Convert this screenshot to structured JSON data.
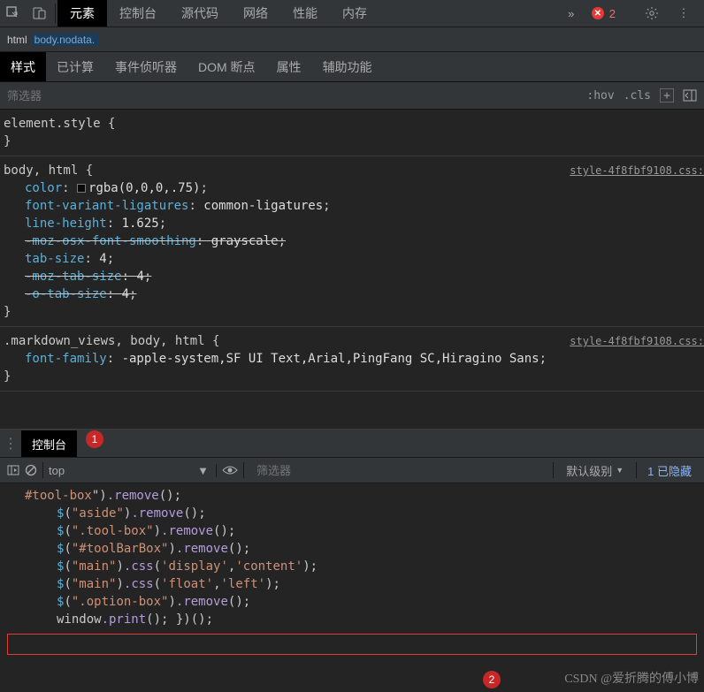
{
  "topbar": {
    "tabs": [
      "元素",
      "控制台",
      "源代码",
      "网络",
      "性能",
      "内存"
    ],
    "active_index": 0,
    "more_label": "»",
    "error_count": "2"
  },
  "breadcrumb": {
    "root": "html",
    "current": "body.nodata."
  },
  "styles_tabs": {
    "items": [
      "样式",
      "已计算",
      "事件侦听器",
      "DOM 断点",
      "属性",
      "辅助功能"
    ],
    "active_index": 0
  },
  "filter": {
    "placeholder": "筛选器",
    "hov": ":hov",
    "cls": ".cls",
    "plus": "+"
  },
  "css_rules": [
    {
      "selector": "element.style",
      "source": "",
      "decls": []
    },
    {
      "selector": "body, html",
      "source": "style-4f8fbf9108.css:",
      "decls": [
        {
          "prop": "color",
          "val": "rgba(0,0,0,.75)",
          "swatch": true,
          "strike": false
        },
        {
          "prop": "font-variant-ligatures",
          "val": "common-ligatures",
          "strike": false
        },
        {
          "prop": "line-height",
          "val": "1.625",
          "strike": false
        },
        {
          "prop": "-moz-osx-font-smoothing",
          "val": "grayscale",
          "strike": true
        },
        {
          "prop": "tab-size",
          "val": "4",
          "strike": false
        },
        {
          "prop": "-moz-tab-size",
          "val": "4",
          "strike": true
        },
        {
          "prop": "-o-tab-size",
          "val": "4",
          "strike": true
        }
      ]
    },
    {
      "selector": ".markdown_views, body, html",
      "source": "style-4f8fbf9108.css:",
      "decls": [
        {
          "prop": "font-family",
          "val": "-apple-system,SF UI Text,Arial,PingFang SC,Hiragino Sans",
          "strike": false
        }
      ]
    }
  ],
  "drawer": {
    "tab_label": "控制台",
    "annotation1": "1"
  },
  "console": {
    "context": "top",
    "filter_placeholder": "筛选器",
    "level": "默认级别",
    "hidden": "1 已隐藏",
    "lines": [
      [
        {
          "t": "#tool-box",
          "c": "js-s"
        },
        {
          "t": "\")",
          "c": "js-p"
        },
        {
          "t": ".remove",
          "c": "js-m"
        },
        {
          "t": "();",
          "c": "js-p"
        }
      ],
      [
        {
          "t": "$",
          "c": "js-fn"
        },
        {
          "t": "(",
          "c": "js-p"
        },
        {
          "t": "\"aside\"",
          "c": "js-s"
        },
        {
          "t": ")",
          "c": "js-p"
        },
        {
          "t": ".remove",
          "c": "js-m"
        },
        {
          "t": "();",
          "c": "js-p"
        }
      ],
      [
        {
          "t": "$",
          "c": "js-fn"
        },
        {
          "t": "(",
          "c": "js-p"
        },
        {
          "t": "\".tool-box\"",
          "c": "js-s"
        },
        {
          "t": ")",
          "c": "js-p"
        },
        {
          "t": ".remove",
          "c": "js-m"
        },
        {
          "t": "();",
          "c": "js-p"
        }
      ],
      [
        {
          "t": "$",
          "c": "js-fn"
        },
        {
          "t": "(",
          "c": "js-p"
        },
        {
          "t": "\"#toolBarBox\"",
          "c": "js-s"
        },
        {
          "t": ")",
          "c": "js-p"
        },
        {
          "t": ".remove",
          "c": "js-m"
        },
        {
          "t": "();",
          "c": "js-p"
        }
      ],
      [
        {
          "t": "$",
          "c": "js-fn"
        },
        {
          "t": "(",
          "c": "js-p"
        },
        {
          "t": "\"main\"",
          "c": "js-s"
        },
        {
          "t": ")",
          "c": "js-p"
        },
        {
          "t": ".css",
          "c": "js-m"
        },
        {
          "t": "(",
          "c": "js-p"
        },
        {
          "t": "'display'",
          "c": "js-s"
        },
        {
          "t": ",",
          "c": "js-p"
        },
        {
          "t": "'content'",
          "c": "js-s"
        },
        {
          "t": ");",
          "c": "js-p"
        }
      ],
      [
        {
          "t": "$",
          "c": "js-fn"
        },
        {
          "t": "(",
          "c": "js-p"
        },
        {
          "t": "\"main\"",
          "c": "js-s"
        },
        {
          "t": ")",
          "c": "js-p"
        },
        {
          "t": ".css",
          "c": "js-m"
        },
        {
          "t": "(",
          "c": "js-p"
        },
        {
          "t": "'float'",
          "c": "js-s"
        },
        {
          "t": ",",
          "c": "js-p"
        },
        {
          "t": "'left'",
          "c": "js-s"
        },
        {
          "t": ");",
          "c": "js-p"
        }
      ],
      [
        {
          "t": "$",
          "c": "js-fn"
        },
        {
          "t": "(",
          "c": "js-p"
        },
        {
          "t": "\".option-box\"",
          "c": "js-s"
        },
        {
          "t": ")",
          "c": "js-p"
        },
        {
          "t": ".remove",
          "c": "js-m"
        },
        {
          "t": "();",
          "c": "js-p"
        }
      ],
      [
        {
          "t": "window",
          "c": "js-p"
        },
        {
          "t": ".print",
          "c": "js-m"
        },
        {
          "t": "(); })();",
          "c": "js-p"
        }
      ]
    ],
    "annotation2": "2"
  },
  "watermark": "CSDN @爱折腾的傅小博"
}
